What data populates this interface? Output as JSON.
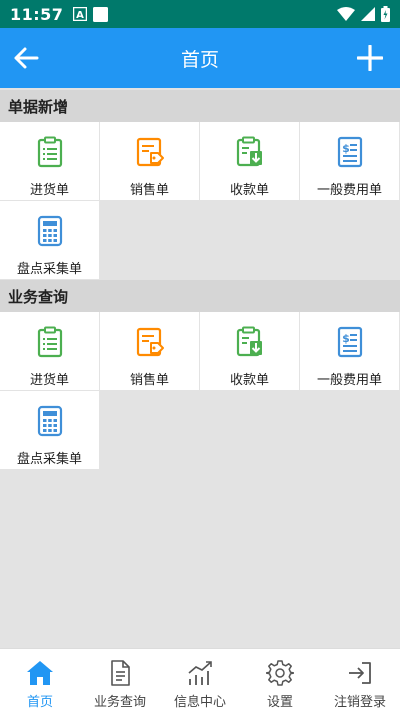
{
  "status_bar": {
    "time": "11:57"
  },
  "app_bar": {
    "title": "首页"
  },
  "sections": [
    {
      "header": "单据新增",
      "tiles": [
        {
          "label": "进货单"
        },
        {
          "label": "销售单"
        },
        {
          "label": "收款单"
        },
        {
          "label": "一般费用单"
        },
        {
          "label": "盘点采集单"
        }
      ]
    },
    {
      "header": "业务查询",
      "tiles": [
        {
          "label": "进货单"
        },
        {
          "label": "销售单"
        },
        {
          "label": "收款单"
        },
        {
          "label": "一般费用单"
        },
        {
          "label": "盘点采集单"
        }
      ]
    }
  ],
  "bottom_nav": [
    {
      "label": "首页",
      "icon": "home-icon",
      "active": true
    },
    {
      "label": "业务查询",
      "icon": "document-icon",
      "active": false
    },
    {
      "label": "信息中心",
      "icon": "chart-icon",
      "active": false
    },
    {
      "label": "设置",
      "icon": "gear-icon",
      "active": false
    },
    {
      "label": "注销登录",
      "icon": "logout-icon",
      "active": false
    }
  ],
  "colors": {
    "status_bar": "#00796b",
    "app_bar": "#2196f3",
    "green": "#4caf50",
    "orange": "#ff8a00",
    "blue": "#3f8fd8"
  }
}
